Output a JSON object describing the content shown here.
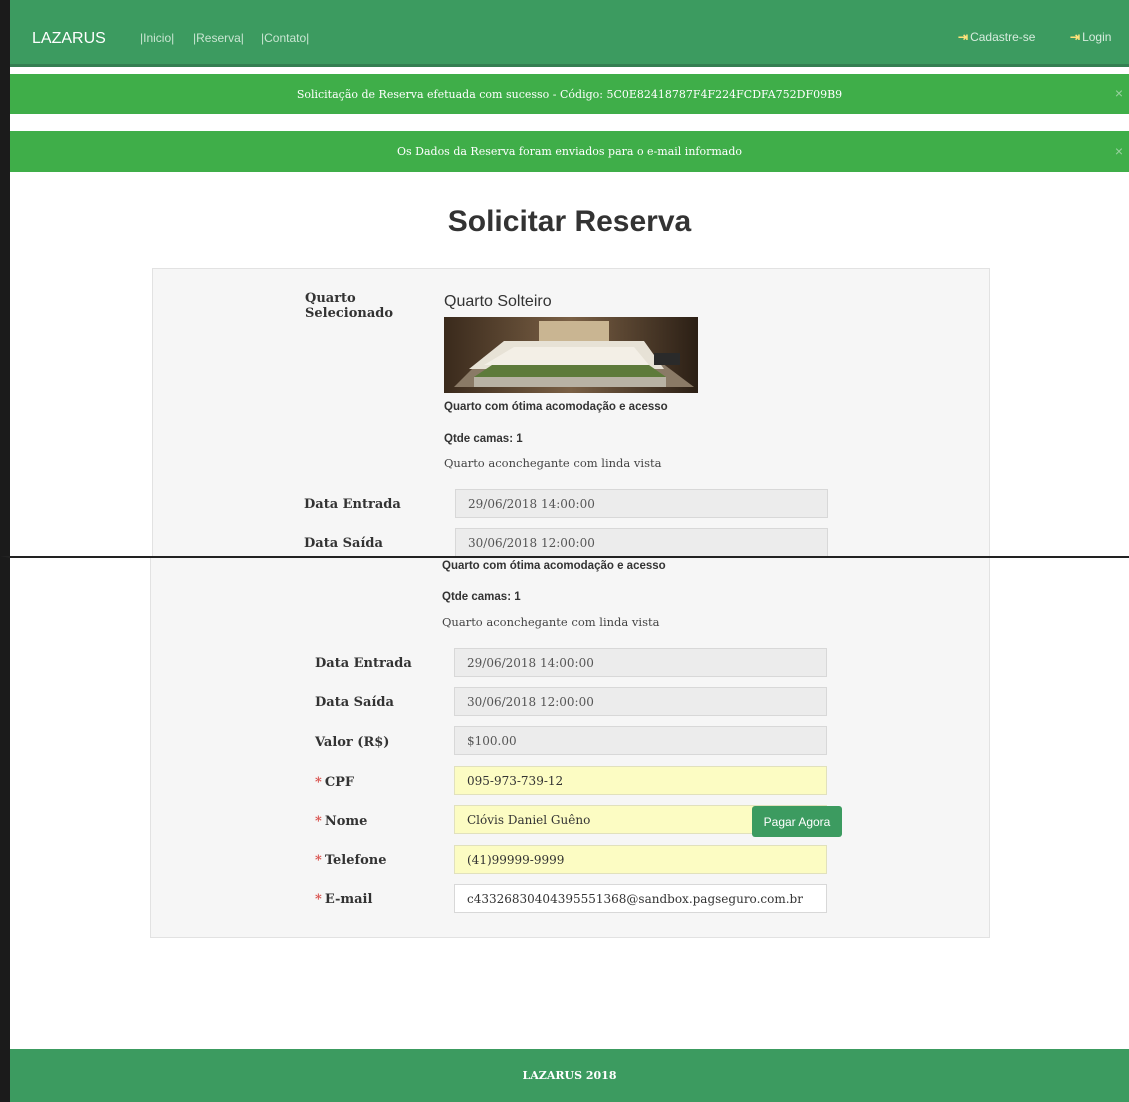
{
  "nav": {
    "brand": "LAZARUS",
    "links": [
      "|Inicio|",
      "|Reserva|",
      "|Contato|"
    ],
    "signup": "Cadastre-se",
    "login": "Login"
  },
  "alerts": [
    "Solicitação de Reserva efetuada com sucesso - Código: 5C0E82418787F4F224FCDFA752DF09B9",
    "Os Dados da Reserva foram enviados para o e-mail informado"
  ],
  "close_symbol": "×",
  "page_title": "Solicitar Reserva",
  "room": {
    "label_line1": "Quarto",
    "label_line2": "Selecionado",
    "name": "Quarto Solteiro",
    "headline": "Quarto com ótima acomodação e acesso",
    "beds": "Qtde camas: 1",
    "description": "Quarto aconchegante com linda vista"
  },
  "form": {
    "entrada_label": "Data Entrada",
    "entrada_value": "29/06/2018 14:00:00",
    "saida_label": "Data Saída",
    "saida_value": "30/06/2018 12:00:00",
    "valor_label": "Valor (R$)",
    "valor_value": "$100.00",
    "required_mark": "*",
    "cpf_label": "CPF",
    "cpf_value": "095-973-739-12",
    "nome_label": "Nome",
    "nome_value": "Clóvis Daniel Guêno",
    "telefone_label": "Telefone",
    "telefone_value": "(41)99999-9999",
    "email_label": "E-mail",
    "email_value": "c43326830404395551368@sandbox.pagseguro.com.br"
  },
  "pay_button": "Pagar Agora",
  "footer": "LAZARUS 2018",
  "colors": {
    "nav_green": "#3c9b60",
    "alert_green": "#3fae49",
    "required_red": "#d9534f",
    "readonly_field": "#ececec",
    "filled_field": "#fcfcc3"
  },
  "icons": {
    "signup": "sign-in-icon",
    "login": "sign-in-icon",
    "close": "close-icon"
  }
}
